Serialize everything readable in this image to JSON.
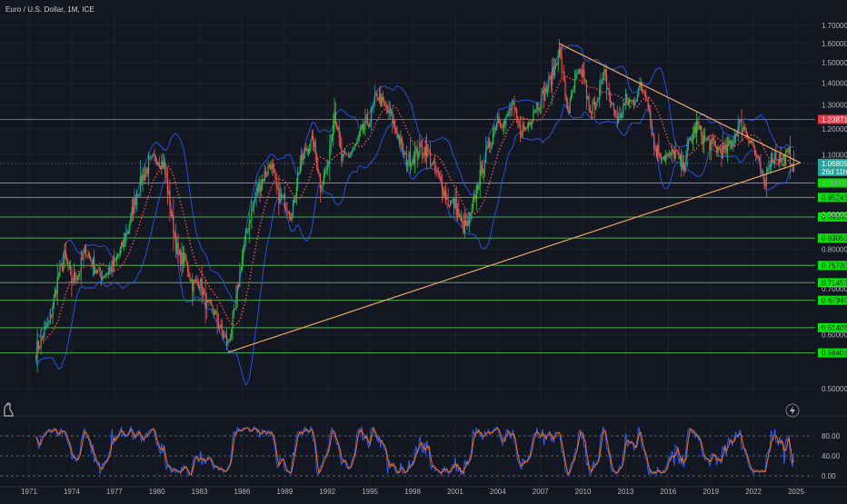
{
  "title": "Euro / U.S. Dollar, 1M, ICE",
  "colors": {
    "background": "#131722",
    "grid": "#1e222d",
    "axis_text": "#b2b5be",
    "candle_up": "#26a69a",
    "candle_up_bright": "#2fbf3a",
    "candle_down": "#ef5350",
    "bollinger": "#2962ff",
    "ma_dotted": "#ef5350",
    "red_level": "#f23645",
    "green_level": "#4caf50",
    "green_label": "#00e600",
    "trendline": "#f0a560",
    "stoch_k": "#2962ff",
    "stoch_d": "#ff6d00"
  },
  "chart_data": [
    {
      "type": "line",
      "title": "Euro / U.S. Dollar, 1M, ICE",
      "x_ticks": [
        "1971",
        "1974",
        "1977",
        "1980",
        "1983",
        "1986",
        "1989",
        "1992",
        "1995",
        "1998",
        "2001",
        "2004",
        "2007",
        "2010",
        "2013",
        "2016",
        "2019",
        "2022",
        "2025"
      ],
      "y_ticks": [
        "1.70000",
        "1.60000",
        "1.50000",
        "1.40000",
        "1.30000",
        "1.20000",
        "1.10000",
        "1.00000",
        "0.90000",
        "0.80000",
        "0.70000",
        "0.60000",
        "0.50000"
      ],
      "ylim": [
        0.48,
        1.72
      ],
      "xlim": [
        1971,
        2025
      ],
      "y_scale": "log",
      "series": [
        {
          "name": "price",
          "points": [
            [
              1971.5,
              0.57
            ],
            [
              1972.0,
              0.6
            ],
            [
              1972.5,
              0.63
            ],
            [
              1973.0,
              0.72
            ],
            [
              1973.5,
              0.78
            ],
            [
              1974.0,
              0.72
            ],
            [
              1974.5,
              0.74
            ],
            [
              1975.0,
              0.8
            ],
            [
              1975.5,
              0.76
            ],
            [
              1976.0,
              0.73
            ],
            [
              1976.5,
              0.74
            ],
            [
              1977.0,
              0.76
            ],
            [
              1977.5,
              0.8
            ],
            [
              1978.0,
              0.86
            ],
            [
              1978.5,
              0.95
            ],
            [
              1979.0,
              1.02
            ],
            [
              1979.5,
              1.07
            ],
            [
              1980.0,
              1.09
            ],
            [
              1980.5,
              1.06
            ],
            [
              1981.0,
              0.9
            ],
            [
              1981.5,
              0.78
            ],
            [
              1982.0,
              0.77
            ],
            [
              1982.5,
              0.71
            ],
            [
              1983.0,
              0.72
            ],
            [
              1983.5,
              0.66
            ],
            [
              1984.0,
              0.65
            ],
            [
              1984.5,
              0.61
            ],
            [
              1985.0,
              0.58
            ],
            [
              1985.5,
              0.65
            ],
            [
              1986.0,
              0.78
            ],
            [
              1986.5,
              0.88
            ],
            [
              1987.0,
              0.97
            ],
            [
              1987.5,
              1.02
            ],
            [
              1988.0,
              1.07
            ],
            [
              1988.5,
              0.96
            ],
            [
              1989.0,
              0.94
            ],
            [
              1989.5,
              0.9
            ],
            [
              1990.0,
              1.05
            ],
            [
              1990.5,
              1.12
            ],
            [
              1991.0,
              1.15
            ],
            [
              1991.5,
              1.0
            ],
            [
              1992.0,
              1.05
            ],
            [
              1992.5,
              1.28
            ],
            [
              1993.0,
              1.08
            ],
            [
              1993.5,
              1.1
            ],
            [
              1994.0,
              1.13
            ],
            [
              1994.5,
              1.2
            ],
            [
              1995.0,
              1.24
            ],
            [
              1995.5,
              1.35
            ],
            [
              1996.0,
              1.29
            ],
            [
              1996.5,
              1.25
            ],
            [
              1997.0,
              1.17
            ],
            [
              1997.5,
              1.08
            ],
            [
              1998.0,
              1.09
            ],
            [
              1998.5,
              1.12
            ],
            [
              1999.0,
              1.12
            ],
            [
              1999.5,
              1.05
            ],
            [
              2000.0,
              1.0
            ],
            [
              2000.5,
              0.94
            ],
            [
              2001.0,
              0.93
            ],
            [
              2001.5,
              0.86
            ],
            [
              2002.0,
              0.87
            ],
            [
              2002.5,
              0.98
            ],
            [
              2003.0,
              1.07
            ],
            [
              2003.5,
              1.15
            ],
            [
              2004.0,
              1.25
            ],
            [
              2004.5,
              1.22
            ],
            [
              2005.0,
              1.3
            ],
            [
              2005.5,
              1.2
            ],
            [
              2006.0,
              1.2
            ],
            [
              2006.5,
              1.28
            ],
            [
              2007.0,
              1.32
            ],
            [
              2007.5,
              1.38
            ],
            [
              2008.0,
              1.47
            ],
            [
              2008.3,
              1.57
            ],
            [
              2008.8,
              1.32
            ],
            [
              2009.0,
              1.28
            ],
            [
              2009.5,
              1.42
            ],
            [
              2010.0,
              1.45
            ],
            [
              2010.5,
              1.25
            ],
            [
              2011.0,
              1.34
            ],
            [
              2011.5,
              1.44
            ],
            [
              2012.0,
              1.3
            ],
            [
              2012.5,
              1.23
            ],
            [
              2013.0,
              1.32
            ],
            [
              2013.5,
              1.31
            ],
            [
              2014.0,
              1.38
            ],
            [
              2014.5,
              1.35
            ],
            [
              2015.0,
              1.13
            ],
            [
              2015.5,
              1.1
            ],
            [
              2016.0,
              1.09
            ],
            [
              2016.5,
              1.11
            ],
            [
              2017.0,
              1.05
            ],
            [
              2017.5,
              1.15
            ],
            [
              2018.0,
              1.21
            ],
            [
              2018.5,
              1.16
            ],
            [
              2019.0,
              1.14
            ],
            [
              2019.5,
              1.12
            ],
            [
              2020.0,
              1.11
            ],
            [
              2020.5,
              1.15
            ],
            [
              2021.0,
              1.22
            ],
            [
              2021.5,
              1.19
            ],
            [
              2022.0,
              1.13
            ],
            [
              2022.5,
              1.04
            ],
            [
              2022.8,
              0.98
            ],
            [
              2023.0,
              1.07
            ],
            [
              2023.5,
              1.1
            ],
            [
              2024.0,
              1.08
            ],
            [
              2024.5,
              1.1
            ],
            [
              2024.8,
              1.06
            ]
          ]
        }
      ],
      "annotations": {
        "red_level": "1.23871",
        "price_label_1": "1.06809",
        "price_label_2": "26d 11h",
        "levels": [
          "1.00000",
          "0.95243",
          "0.89160",
          "0.83050",
          "0.75730",
          "0.71453",
          "0.67340",
          "0.61405",
          "0.56402"
        ]
      }
    },
    {
      "type": "line",
      "title": "",
      "x_ticks": [
        "1971",
        "1974",
        "1977",
        "1980",
        "1983",
        "1986",
        "1989",
        "1992",
        "1995",
        "1998",
        "2001",
        "2004",
        "2007",
        "2010",
        "2013",
        "2016",
        "2019",
        "2022",
        "2025"
      ],
      "y_ticks": [
        "80.00",
        "40.00",
        "0.00"
      ],
      "ylim": [
        -5,
        100
      ]
    }
  ]
}
